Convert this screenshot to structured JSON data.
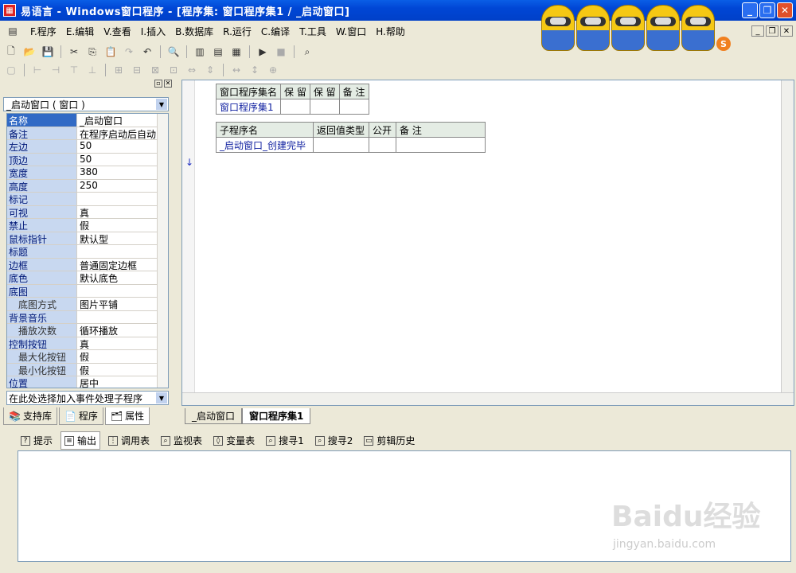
{
  "window": {
    "title": "易语言 - Windows窗口程序 - [程序集: 窗口程序集1 / _启动窗口]"
  },
  "menu": [
    {
      "key": "F.",
      "label": "程序"
    },
    {
      "key": "E.",
      "label": "编辑"
    },
    {
      "key": "V.",
      "label": "查看"
    },
    {
      "key": "I.",
      "label": "插入"
    },
    {
      "key": "B.",
      "label": "数据库"
    },
    {
      "key": "R.",
      "label": "运行"
    },
    {
      "key": "C.",
      "label": "编译"
    },
    {
      "key": "T.",
      "label": "工具"
    },
    {
      "key": "W.",
      "label": "窗口"
    },
    {
      "key": "H.",
      "label": "帮助"
    }
  ],
  "left_panel": {
    "object_combo": "_启动窗口 ( 窗口 )",
    "properties": [
      {
        "name": "名称",
        "value": "_启动窗口",
        "selected": true
      },
      {
        "name": "备注",
        "value": "在程序启动后自动"
      },
      {
        "name": "左边",
        "value": "50"
      },
      {
        "name": "顶边",
        "value": "50"
      },
      {
        "name": "宽度",
        "value": "380"
      },
      {
        "name": "高度",
        "value": "250"
      },
      {
        "name": "标记",
        "value": ""
      },
      {
        "name": "可视",
        "value": "真"
      },
      {
        "name": "禁止",
        "value": "假"
      },
      {
        "name": "鼠标指针",
        "value": "默认型"
      },
      {
        "name": "标题",
        "value": ""
      },
      {
        "name": "边框",
        "value": "普通固定边框"
      },
      {
        "name": "底色",
        "value": "默认底色"
      },
      {
        "name": "底图",
        "value": ""
      },
      {
        "name": "底图方式",
        "value": "图片平铺",
        "sub": true
      },
      {
        "name": "背景音乐",
        "value": ""
      },
      {
        "name": "播放次数",
        "value": "循环播放",
        "sub": true
      },
      {
        "name": "控制按钮",
        "value": "真"
      },
      {
        "name": "最大化按钮",
        "value": "假",
        "sub": true
      },
      {
        "name": "最小化按钮",
        "value": "假",
        "sub": true
      },
      {
        "name": "位置",
        "value": "居中"
      }
    ],
    "event_combo": "在此处选择加入事件处理子程序",
    "tabs": [
      "支持库",
      "程序",
      "属性"
    ]
  },
  "editor": {
    "table1": {
      "headers": [
        "窗口程序集名",
        "保  留",
        "保  留",
        "备 注"
      ],
      "row": [
        "窗口程序集1",
        "",
        "",
        ""
      ]
    },
    "table2": {
      "headers": [
        "子程序名",
        "返回值类型",
        "公开",
        "备 注"
      ],
      "row": [
        "_启动窗口_创建完毕",
        "",
        "",
        ""
      ]
    },
    "tabs": [
      "_启动窗口",
      "窗口程序集1"
    ]
  },
  "bottom_tabs": [
    "提示",
    "输出",
    "调用表",
    "监视表",
    "变量表",
    "搜寻1",
    "搜寻2",
    "剪辑历史"
  ],
  "watermark": {
    "main": "Baidu经验",
    "sub": "jingyan.baidu.com"
  }
}
